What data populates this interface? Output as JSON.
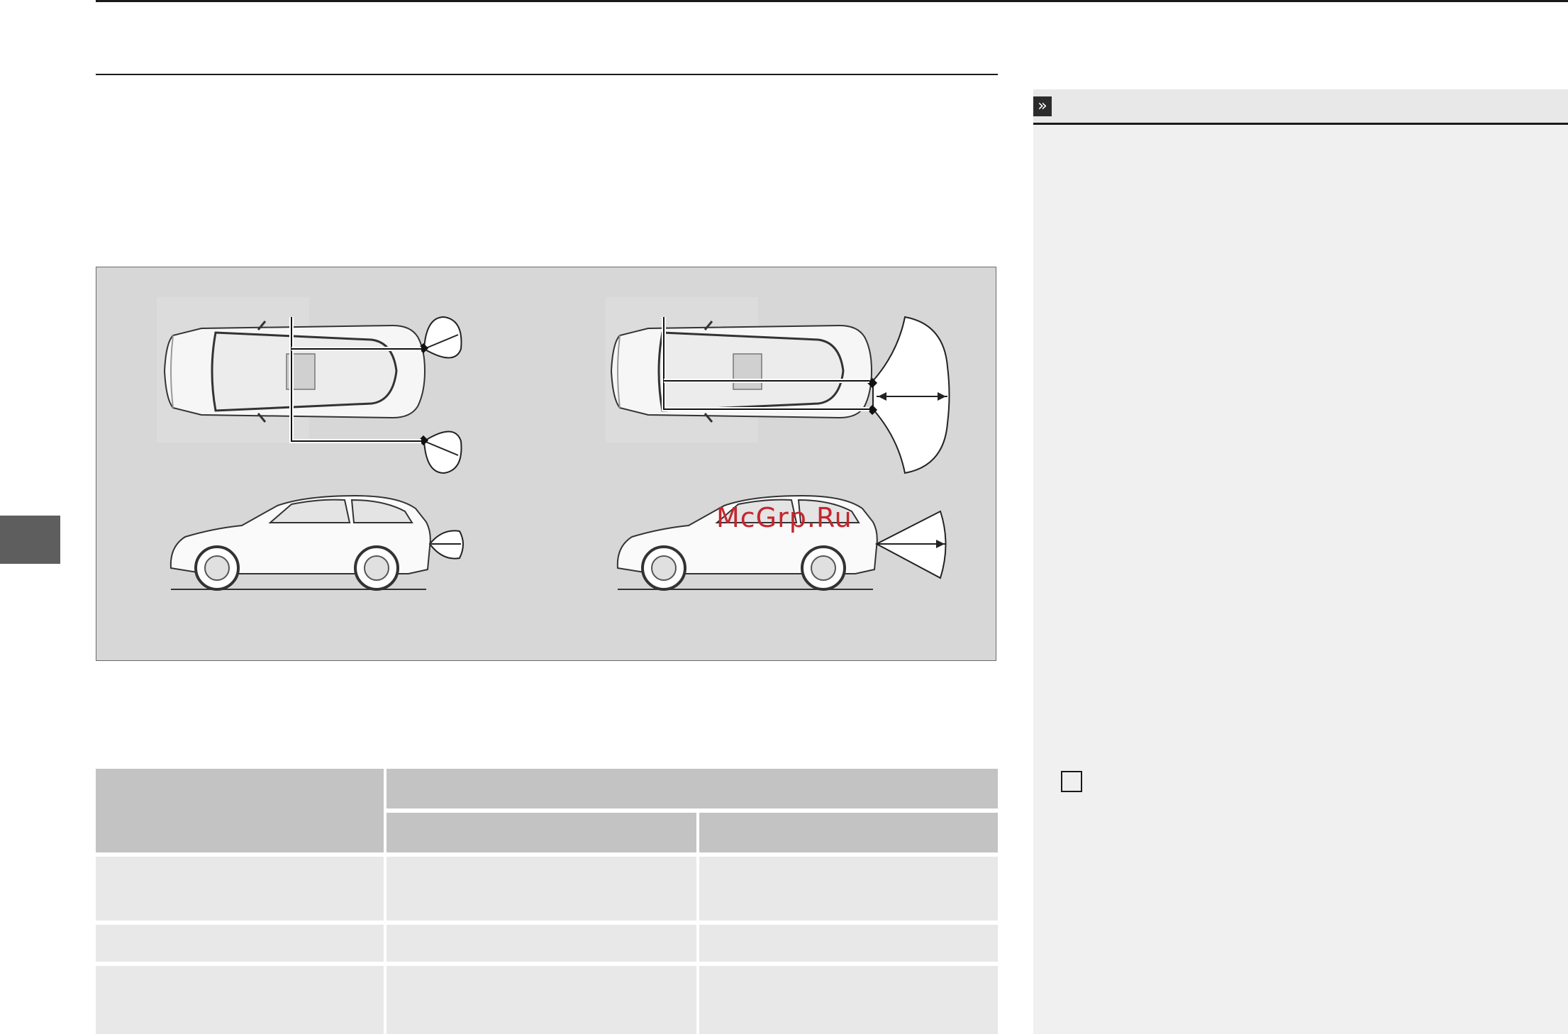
{
  "page": {
    "header_text": "",
    "section_title": ""
  },
  "figure": {
    "watermark": "McGrp.Ru",
    "views": [
      {
        "name": "front-sensors-top-view"
      },
      {
        "name": "rear-sensors-top-view"
      },
      {
        "name": "front-sensors-side-view"
      },
      {
        "name": "rear-sensors-side-view"
      }
    ]
  },
  "table": {
    "headers": [
      "",
      "",
      "",
      ""
    ],
    "rows": [
      [
        "",
        "",
        ""
      ],
      [
        "",
        "",
        ""
      ],
      [
        "",
        "",
        ""
      ]
    ]
  },
  "note_panel": {
    "ref_icon": "double-chevron-right-icon",
    "title": "",
    "body": ""
  },
  "colors": {
    "figure_bg": "#d7d7d7",
    "header_cell": "#c3c3c3",
    "row_cell": "#e8e8e8",
    "panel_bg": "#f0f0f0",
    "watermark": "#c4262e",
    "side_tab": "#5e5e5e"
  }
}
